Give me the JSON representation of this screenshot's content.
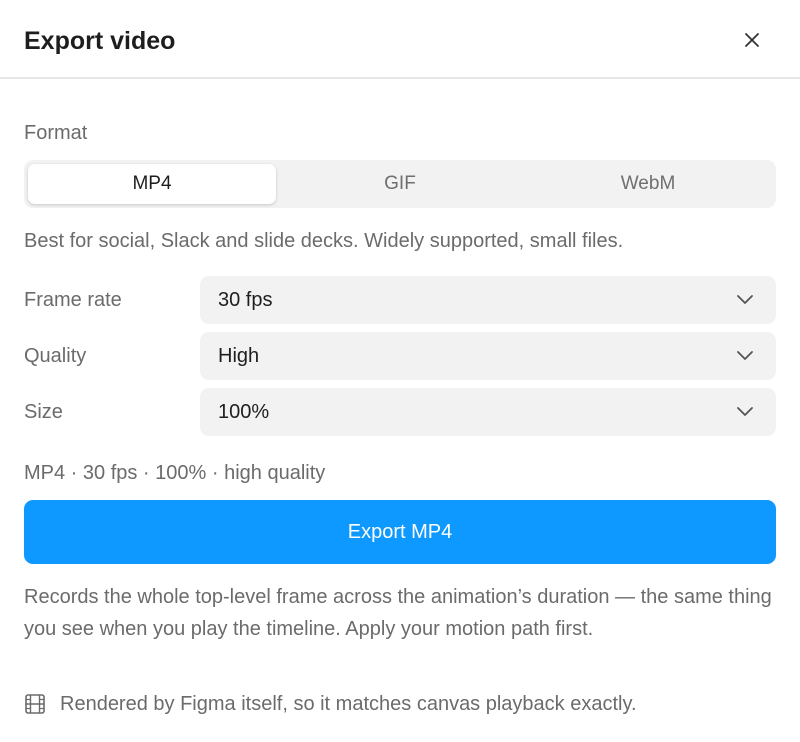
{
  "dialog": {
    "title": "Export video",
    "close_icon": "close-icon"
  },
  "format": {
    "label": "Format",
    "options": [
      {
        "label": "MP4",
        "active": true
      },
      {
        "label": "GIF",
        "active": false
      },
      {
        "label": "WebM",
        "active": false
      }
    ],
    "description": "Best for social, Slack and slide decks. Widely supported, small files."
  },
  "settings": {
    "frame_rate": {
      "label": "Frame rate",
      "value": "30 fps"
    },
    "quality": {
      "label": "Quality",
      "value": "High"
    },
    "size": {
      "label": "Size",
      "value": "100%"
    }
  },
  "summary": "MP4 · 30 fps · 100% · high quality",
  "export_button": {
    "label": "Export MP4"
  },
  "note": "Records the whole top-level frame across the animation’s duration — the same thing you see when you play the timeline. Apply your motion path first.",
  "footer": {
    "icon": "film-icon",
    "text": "Rendered by Figma itself, so it matches canvas playback exactly."
  },
  "colors": {
    "accent": "#0d99ff",
    "control_bg": "#f2f2f2",
    "muted_text": "#6b6b6b",
    "primary_text": "#1e1e1e"
  }
}
